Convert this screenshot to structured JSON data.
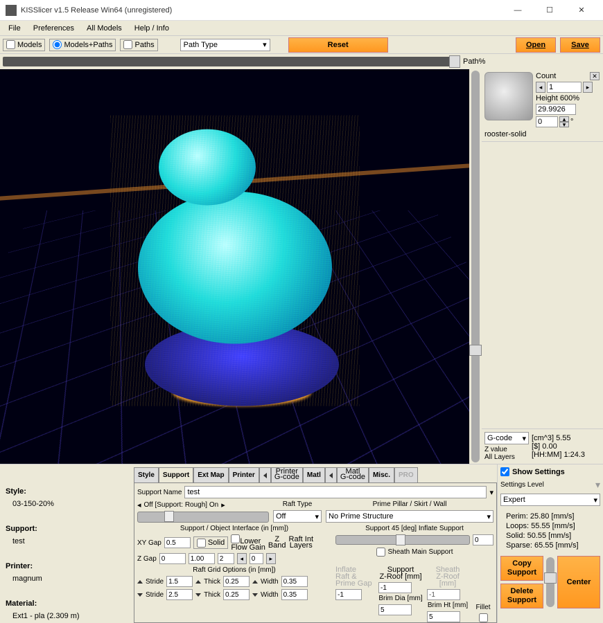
{
  "window": {
    "title": "KISSlicer v1.5 Release Win64 (unregistered)"
  },
  "menubar": {
    "items": [
      "File",
      "Preferences",
      "All Models",
      "Help / Info"
    ]
  },
  "toolbar": {
    "view_modes": {
      "models": "Models",
      "models_paths": "Models+Paths",
      "paths": "Paths",
      "selected": "models_paths"
    },
    "pathtype": "Path Type",
    "reset": "Reset",
    "open": "Open",
    "save": "Save",
    "path_pct": "Path%"
  },
  "model_tile": {
    "name": "rooster-solid",
    "count_label": "Count",
    "count": "1",
    "height_label": "Height 600%",
    "height": "29.9926",
    "zoffset": "0"
  },
  "gcode": {
    "label": "G-code",
    "zvalue": "Z value",
    "all_layers": "All Layers",
    "stat1": "[cm^3]  5.55",
    "stat2": "   [$]  0.00",
    "stat3": "[HH:MM]  1:24.3"
  },
  "left_info": {
    "style_h": "Style:",
    "style_v": "03-150-20%",
    "support_h": "Support:",
    "support_v": "test",
    "printer_h": "Printer:",
    "printer_v": "magnum",
    "material_h": "Material:",
    "material_v": "Ext1 - pla (2.309 m)"
  },
  "tabs": {
    "names": [
      "Style",
      "Support",
      "Ext Map",
      "Printer",
      "Matl",
      "Misc.",
      "PRO"
    ],
    "printer_sub": [
      "Printer",
      "G-code"
    ],
    "matl_sub": [
      "Matl",
      "G-code"
    ],
    "active": "Support"
  },
  "support_tab": {
    "name_label": "Support Name",
    "name": "test",
    "slider_left": "Off [Support: Rough] On",
    "raft_type_label": "Raft Type",
    "raft_type": "Off",
    "prime_label": "Prime Pillar / Skirt /  Wall",
    "prime": "No Prime Structure",
    "interface_title": "Support / Object Interface (in [mm])",
    "xy_gap_label": "XY Gap",
    "xy_gap": "0.5",
    "solid_label": "Solid",
    "lower_label": "Lower",
    "flow_gain_label": "Flow Gain",
    "z_gap_label": "Z Gap",
    "z_gap": "0",
    "flow_gain": "1.00",
    "z_band_label": "Z\nBand",
    "z_band": "2",
    "raft_int_label": "Raft Int\nLayers",
    "raft_int": "0",
    "support45_label": "Support 45 [deg] Inflate Support",
    "support45": "0",
    "sheath_label": "Sheath Main Support",
    "inflate_raft_label": "Inflate\nRaft &\nPrime Gap",
    "inflate_raft": "-1",
    "support_zroof_label": "Support\nZ-Roof [mm]",
    "support_zroof": "-1",
    "sheath_zroof_label": "Sheath\nZ-Roof [mm]",
    "sheath_zroof": "-1",
    "raft_grid_title": "Raft Grid Options (in [mm])",
    "stride1": "1.5",
    "stride2": "2.5",
    "thick1": "0.25",
    "thick2": "0.25",
    "width1": "0.35",
    "width2": "0.35",
    "stride_label": "Stride",
    "thick_label": "Thick",
    "width_label": "Width",
    "brim_dia_label": "Brim Dia [mm]",
    "brim_dia": "5",
    "brim_ht_label": "Brim Ht [mm]",
    "brim_ht": "5",
    "fillet_label": "Fillet"
  },
  "right_settings": {
    "show": "Show Settings",
    "level_label": "Settings Level",
    "level": "Expert",
    "perim": "Perim: 25.80 [mm/s]",
    "loops": "Loops: 55.55 [mm/s]",
    "solid": "Solid: 50.55 [mm/s]",
    "sparse": "Sparse: 65.55 [mm/s]",
    "copy": "Copy Support",
    "delete": "Delete Support",
    "center": "Center"
  }
}
